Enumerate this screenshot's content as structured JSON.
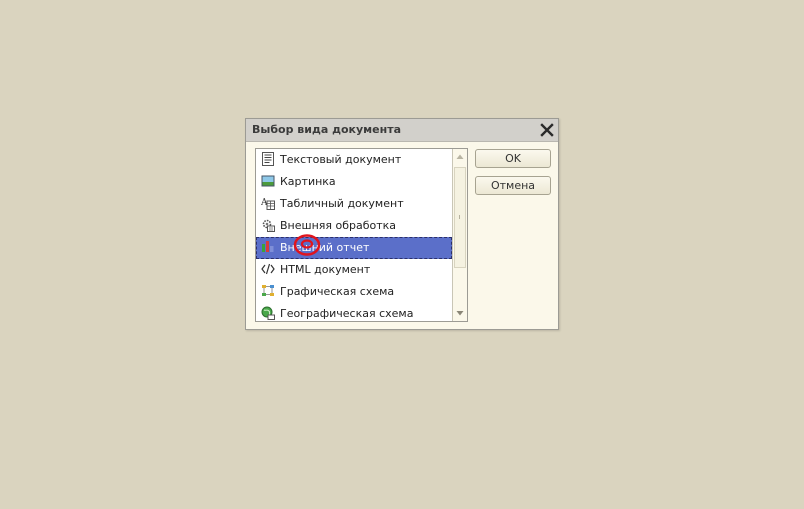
{
  "dialog": {
    "title": "Выбор вида документа",
    "close_icon": "close-icon",
    "items": [
      {
        "label": "Текстовый документ",
        "icon": "text-document-icon",
        "selected": false
      },
      {
        "label": "Картинка",
        "icon": "picture-icon",
        "selected": false
      },
      {
        "label": "Табличный документ",
        "icon": "spreadsheet-document-icon",
        "selected": false
      },
      {
        "label": "Внешняя обработка",
        "icon": "external-processing-icon",
        "selected": false
      },
      {
        "label": "Внешний отчет",
        "icon": "external-report-icon",
        "selected": true
      },
      {
        "label": "HTML документ",
        "icon": "html-document-icon",
        "selected": false
      },
      {
        "label": "Графическая схема",
        "icon": "graphic-scheme-icon",
        "selected": false
      },
      {
        "label": "Географическая схема",
        "icon": "geographic-scheme-icon",
        "selected": false
      }
    ],
    "buttons": {
      "ok": "OK",
      "cancel": "Отмена"
    },
    "colors": {
      "selection": "#5b6fc9",
      "background": "#dad4bf",
      "dialog_bg": "#fbf8ea",
      "cursor_highlight": "#e0141e"
    }
  }
}
